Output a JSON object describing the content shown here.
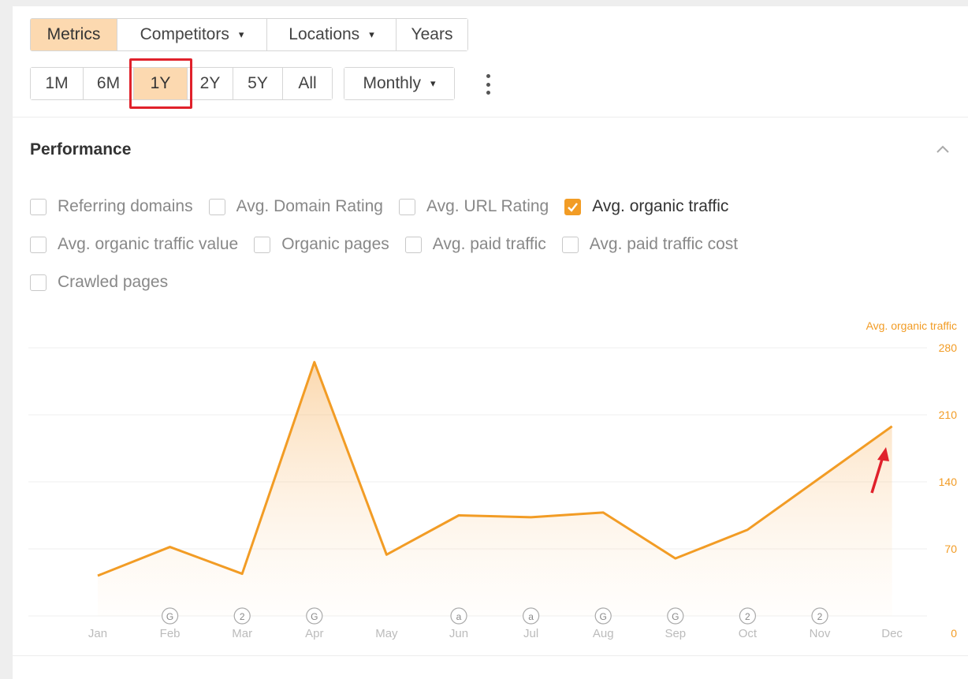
{
  "toolbar": {
    "row1": [
      {
        "label": "Metrics",
        "active": true,
        "dropdown": false
      },
      {
        "label": "Competitors",
        "active": false,
        "dropdown": true
      },
      {
        "label": "Locations",
        "active": false,
        "dropdown": true
      },
      {
        "label": "Years",
        "active": false,
        "dropdown": false
      }
    ],
    "ranges": [
      {
        "label": "1M",
        "active": false
      },
      {
        "label": "6M",
        "active": false
      },
      {
        "label": "1Y",
        "active": true
      },
      {
        "label": "2Y",
        "active": false
      },
      {
        "label": "5Y",
        "active": false
      },
      {
        "label": "All",
        "active": false
      }
    ],
    "interval": "Monthly",
    "caret": "▾"
  },
  "performance": {
    "title": "Performance",
    "checkboxes": [
      [
        {
          "label": "Referring domains",
          "checked": false
        },
        {
          "label": "Avg. Domain Rating",
          "checked": false
        },
        {
          "label": "Avg. URL Rating",
          "checked": false
        },
        {
          "label": "Avg. organic traffic",
          "checked": true
        }
      ],
      [
        {
          "label": "Avg. organic traffic value",
          "checked": false
        },
        {
          "label": "Organic pages",
          "checked": false
        },
        {
          "label": "Avg. paid traffic",
          "checked": false
        },
        {
          "label": "Avg. paid traffic cost",
          "checked": false
        }
      ],
      [
        {
          "label": "Crawled pages",
          "checked": false
        }
      ]
    ]
  },
  "colors": {
    "accent": "#f29c25",
    "active_bg": "#fcd9b0",
    "highlight": "#e0212b",
    "axis_text": "#bbbbbb",
    "marker": "#999999"
  },
  "chart_data": {
    "type": "area",
    "series": [
      {
        "name": "Avg. organic traffic",
        "values": [
          42,
          72,
          44,
          265,
          64,
          105,
          103,
          108,
          60,
          90,
          null,
          198
        ]
      }
    ],
    "categories": [
      "Jan",
      "Feb",
      "Mar",
      "Apr",
      "May",
      "Jun",
      "Jul",
      "Aug",
      "Sep",
      "Oct",
      "Nov",
      "Dec"
    ],
    "y_axis_title": "Avg. organic traffic",
    "y_ticks": [
      0,
      70,
      140,
      210,
      280
    ],
    "ylim": [
      0,
      280
    ],
    "grid": true,
    "markers": [
      {
        "month": "Feb",
        "label": "G"
      },
      {
        "month": "Mar",
        "label": "2"
      },
      {
        "month": "Apr",
        "label": "G"
      },
      {
        "month": "Jun",
        "label": "a"
      },
      {
        "month": "Jul",
        "label": "a"
      },
      {
        "month": "Aug",
        "label": "G"
      },
      {
        "month": "Sep",
        "label": "G"
      },
      {
        "month": "Oct",
        "label": "2"
      },
      {
        "month": "Nov",
        "label": "2"
      }
    ]
  }
}
